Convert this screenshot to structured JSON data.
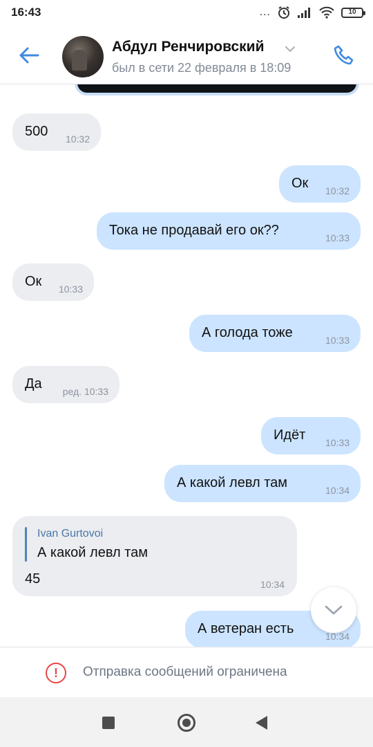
{
  "status_bar": {
    "time": "16:43",
    "more": "...",
    "battery": "10"
  },
  "header": {
    "contact_name": "Абдул Ренчировский",
    "status": "был в сети 22 февраля в 18:09",
    "accent_color": "#3f8ae0"
  },
  "messages": [
    {
      "dir": "in",
      "text": "500",
      "time": "10:32"
    },
    {
      "dir": "out",
      "text": "Ок",
      "time": "10:32"
    },
    {
      "dir": "out",
      "text": "Тока не продавай его ок??",
      "time": "10:33"
    },
    {
      "dir": "in",
      "text": "Ок",
      "time": "10:33"
    },
    {
      "dir": "out",
      "text": "А голода тоже",
      "time": "10:33"
    },
    {
      "dir": "in",
      "text": "Да",
      "time": "ред. 10:33"
    },
    {
      "dir": "out",
      "text": "Идёт",
      "time": "10:33"
    },
    {
      "dir": "out",
      "text": "А какой левл там",
      "time": "10:34"
    },
    {
      "dir": "in",
      "reply_author": "Ivan Gurtovoi",
      "reply_quote": "А какой левл там",
      "text": "45",
      "time": "10:34"
    },
    {
      "dir": "out",
      "text": "А ветеран есть",
      "time": "10:34"
    }
  ],
  "restriction": {
    "icon": "!",
    "text": "Отправка сообщений ограничена",
    "icon_color": "#e64646"
  },
  "icons": {
    "back": "arrow-left-icon",
    "call": "phone-icon",
    "scroll": "chevron-down-icon"
  }
}
